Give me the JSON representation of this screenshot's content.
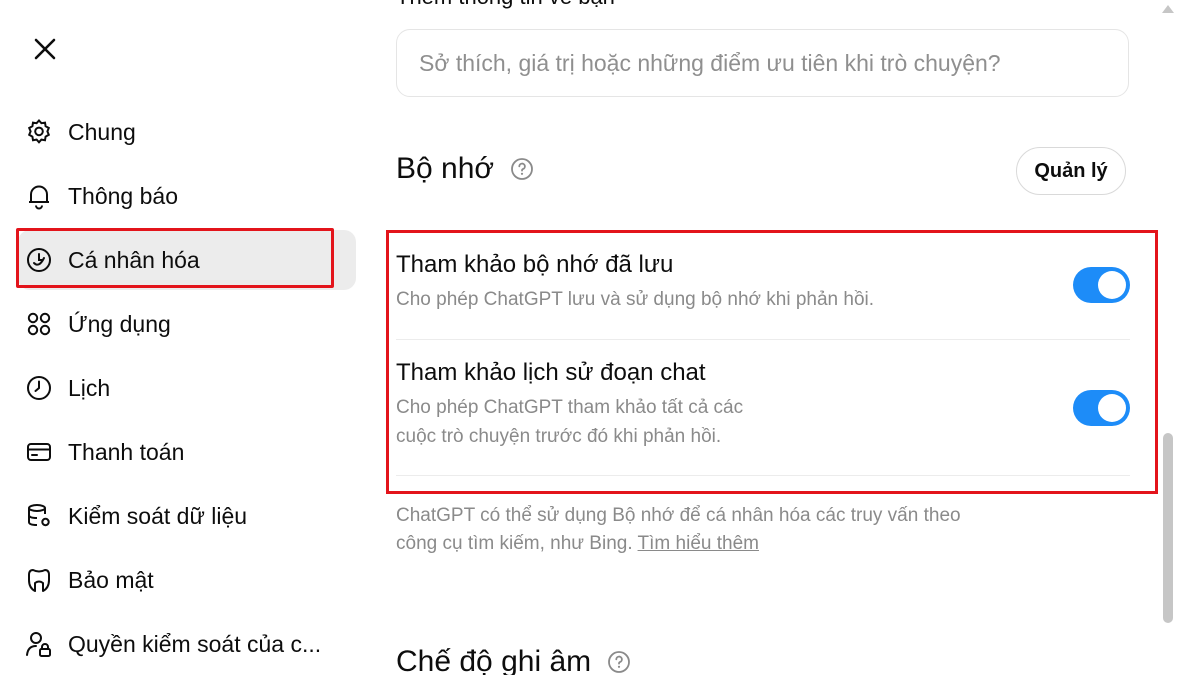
{
  "nav": {
    "items": [
      {
        "label": "Chung",
        "icon": "gear-icon"
      },
      {
        "label": "Thông báo",
        "icon": "bell-icon"
      },
      {
        "label": "Cá nhân hóa",
        "icon": "personalization-icon"
      },
      {
        "label": "Ứng dụng",
        "icon": "apps-grid-icon"
      },
      {
        "label": "Lịch",
        "icon": "clock-icon"
      },
      {
        "label": "Thanh toán",
        "icon": "credit-card-icon"
      },
      {
        "label": "Kiểm soát dữ liệu",
        "icon": "database-icon"
      },
      {
        "label": "Bảo mật",
        "icon": "shield-icon"
      },
      {
        "label": "Quyền kiểm soát của c...",
        "icon": "user-lock-icon"
      }
    ],
    "active": "Cá nhân hóa"
  },
  "main": {
    "peek_title": "Thêm thông tin về bạn",
    "about_input": {
      "placeholder": "Sở thích, giá trị hoặc những điểm ưu tiên khi trò chuyện?",
      "value": ""
    },
    "memory": {
      "title": "Bộ nhớ",
      "manage_label": "Quản lý",
      "saved_title": "Tham khảo bộ nhớ đã lưu",
      "saved_desc": "Cho phép ChatGPT lưu và sử dụng bộ nhớ khi phản hồi.",
      "saved_on": true,
      "history_title": "Tham khảo lịch sử đoạn chat",
      "history_desc_1": "Cho phép ChatGPT tham khảo tất cả các",
      "history_desc_2": "cuộc trò chuyện trước đó khi phản hồi.",
      "history_on": true,
      "note_1": "ChatGPT có thể sử dụng Bộ nhớ để cá nhân hóa các truy vấn theo",
      "note_2": "công cụ tìm kiếm, như Bing.",
      "learn_more": "Tìm hiểu thêm"
    },
    "recording_title": "Chế độ ghi âm"
  },
  "colors": {
    "toggle_on": "#1d8cf8",
    "highlight": "#e3141b",
    "muted_text": "#8a8a8a"
  }
}
